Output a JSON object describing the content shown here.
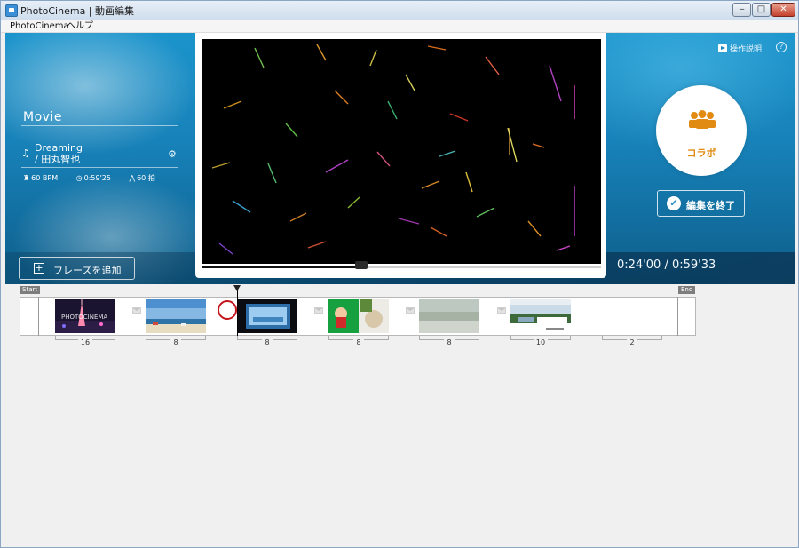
{
  "window": {
    "title": "PhotoCinema | 動画編集",
    "buttons": {
      "minimize": "‒",
      "maximize": "□",
      "close": "✕"
    }
  },
  "menubar": {
    "items": [
      "PhotoCinema",
      "ヘルプ"
    ]
  },
  "header": {
    "help_label": "操作説明",
    "help_icon": "?"
  },
  "sidebar": {
    "movie_label": "Movie",
    "song_title": "Dreaming",
    "song_artist": "/ 田丸智也",
    "bpm": "60 BPM",
    "duration": "0:59'25",
    "beats": "60 拍"
  },
  "toolbar": {
    "add_phrase_label": "フレーズを追加"
  },
  "player": {
    "time_display": "0:24'00 / 0:59'33",
    "progress": 0.4
  },
  "collab": {
    "label": "コラボ"
  },
  "finish": {
    "label": "編集を終了"
  },
  "timeline": {
    "start_label": "Start",
    "end_label": "End",
    "clips": [
      {
        "thumb": "tower-night",
        "overlay": "PHOTOCINEMA",
        "count": "16"
      },
      {
        "thumb": "beach-sky",
        "count": "8"
      },
      {
        "thumb": "ocean-dark",
        "count": "8"
      },
      {
        "thumb": "garden-green",
        "count": "8"
      },
      {
        "thumb": "misty-landscape",
        "count": "8"
      },
      {
        "thumb": "palm-resort",
        "count": "10"
      },
      {
        "thumb": "empty",
        "count": "2"
      }
    ]
  },
  "colors": {
    "accent_orange": "#e28b12",
    "hero_blue": "#1781b8",
    "marker_red": "#c4141c"
  }
}
